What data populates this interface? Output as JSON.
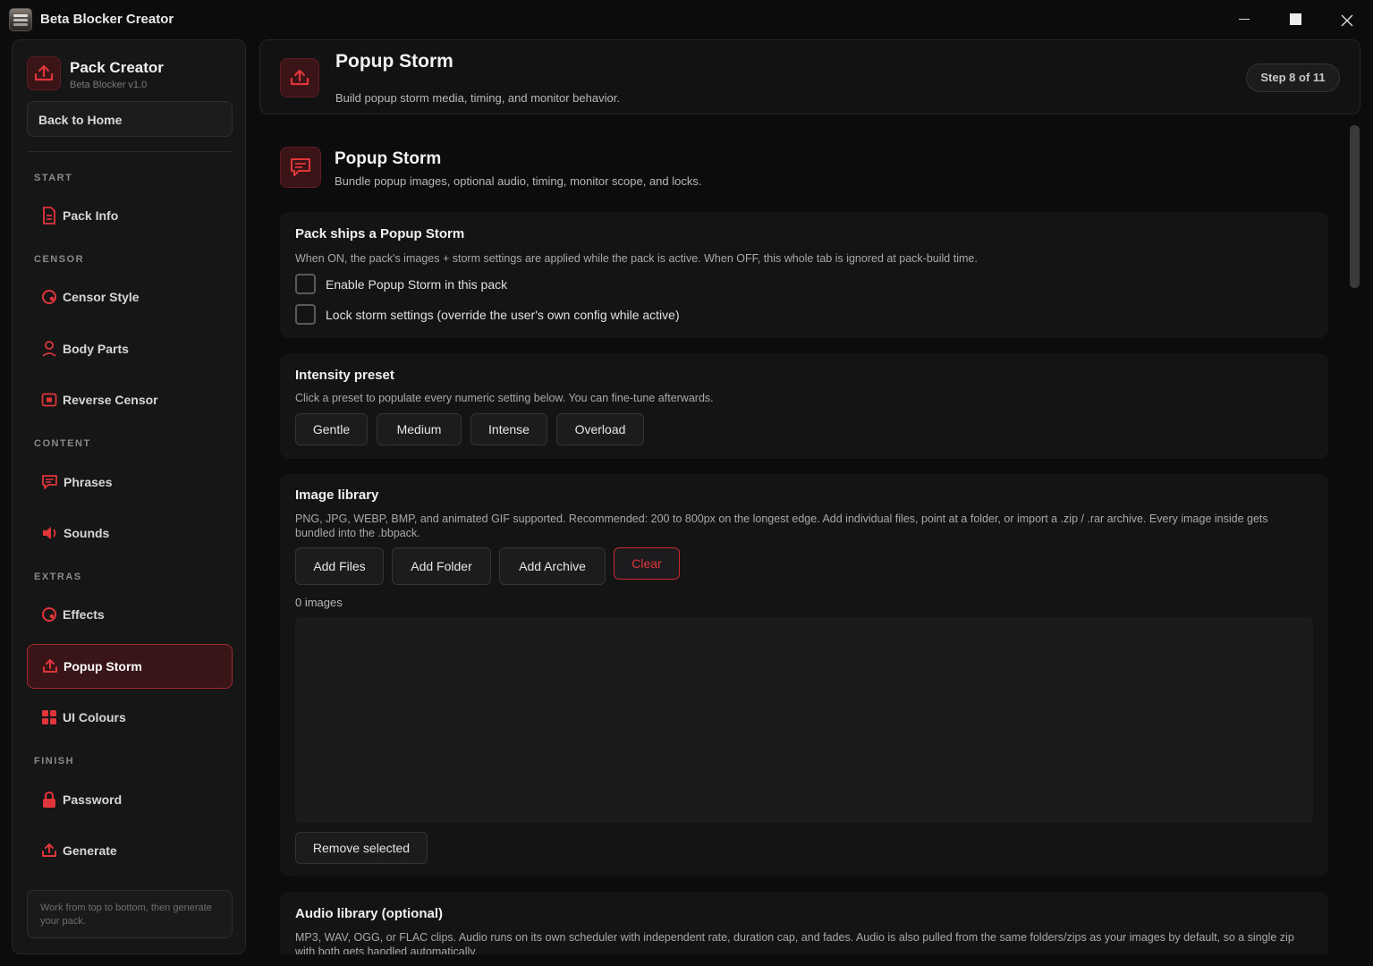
{
  "window": {
    "title": "Beta Blocker Creator"
  },
  "sidebar": {
    "brand_title": "Pack Creator",
    "brand_subtitle": "Beta Blocker v1.0",
    "back_label": "Back to Home",
    "sections": {
      "start": "START",
      "censor": "CENSOR",
      "content": "CONTENT",
      "extras": "EXTRAS",
      "finish": "FINISH"
    },
    "items": {
      "pack_info": "Pack Info",
      "censor_style": "Censor Style",
      "body_parts": "Body Parts",
      "reverse_censor": "Reverse Censor",
      "phrases": "Phrases",
      "sounds": "Sounds",
      "effects": "Effects",
      "popup_storm": "Popup Storm",
      "ui_colours": "UI Colours",
      "password": "Password",
      "generate": "Generate"
    },
    "active_item": "popup_storm",
    "tip": "Work from top to bottom, then generate your pack."
  },
  "header": {
    "title": "Popup Storm",
    "subtitle": "Build popup storm media, timing, and monitor behavior.",
    "step": "Step 8 of 11"
  },
  "section": {
    "title": "Popup Storm",
    "subtitle": "Bundle popup images, optional audio, timing, monitor scope, and locks."
  },
  "ships_card": {
    "title": "Pack ships a Popup Storm",
    "description": "When ON, the pack's images + storm settings are applied while the pack is active. When OFF, this whole tab is ignored at pack-build time.",
    "enable_label": "Enable Popup Storm in this pack",
    "enable_checked": false,
    "lock_label": "Lock storm settings (override the user's own config while active)",
    "lock_checked": false
  },
  "intensity_card": {
    "title": "Intensity preset",
    "description": "Click a preset to populate every numeric setting below. You can fine-tune afterwards.",
    "presets": [
      "Gentle",
      "Medium",
      "Intense",
      "Overload"
    ]
  },
  "image_card": {
    "title": "Image library",
    "description": "PNG, JPG, WEBP, BMP, and animated GIF supported. Recommended: 200 to 800px on the longest edge.  Add individual files, point at a folder, or import a .zip / .rar archive. Every image inside gets bundled into the .bbpack.",
    "add_files": "Add Files",
    "add_folder": "Add Folder",
    "add_archive": "Add Archive",
    "clear": "Clear",
    "count": "0 images",
    "remove_selected": "Remove selected"
  },
  "audio_card": {
    "title": "Audio library (optional)",
    "description": "MP3, WAV, OGG, or FLAC clips. Audio runs on its own scheduler with independent rate, duration cap, and fades. Audio is also pulled from the same folders/zips as your images by default, so a single zip with both gets handled automatically."
  },
  "colors": {
    "accent": "#e0353b",
    "accent_bg": "#3a1518",
    "background": "#0c0c0d",
    "panel": "#141415"
  },
  "icons": {
    "brand": "upload-icon",
    "pack_info": "document-icon",
    "censor_style": "palette-icon",
    "body_parts": "person-icon",
    "reverse_censor": "frame-icon",
    "phrases": "chat-icon",
    "sounds": "speaker-icon",
    "effects": "palette-icon",
    "popup_storm": "upload-icon",
    "ui_colours": "grid-icon",
    "password": "lock-icon",
    "generate": "upload-icon"
  }
}
